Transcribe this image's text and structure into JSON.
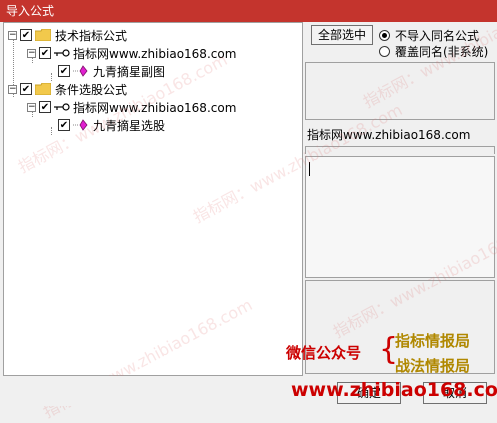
{
  "window": {
    "title": "导入公式"
  },
  "tree": {
    "nodes": [
      {
        "label": "技术指标公式",
        "type": "category"
      },
      {
        "label": "指标网www.zhibiao168.com",
        "type": "group"
      },
      {
        "label": "九青摘星副图",
        "type": "formula"
      },
      {
        "label": "条件选股公式",
        "type": "category"
      },
      {
        "label": "指标网www.zhibiao168.com",
        "type": "group"
      },
      {
        "label": "九青摘星选股",
        "type": "formula"
      }
    ]
  },
  "actions": {
    "select_all_label": "全部选中",
    "ok_label": "确定",
    "cancel_label": "取消"
  },
  "import_options": {
    "options": [
      {
        "label": "不导入同名公式",
        "selected": true
      },
      {
        "label": "覆盖同名(非系统)",
        "selected": false
      }
    ]
  },
  "detail": {
    "source_text": "指标网www.zhibiao168.com",
    "note_text": ""
  },
  "watermark": {
    "text": "指标网：www.zhibiao168.com"
  },
  "promo": {
    "wechat_label": "微信公众号",
    "brace": "{",
    "channel1": "指标情报局",
    "channel2": "战法情报局",
    "url": "www.zhibiao168.com"
  },
  "colors": {
    "titlebar": "#c4342d",
    "check": "#000000",
    "promo_red": "#cc0000",
    "promo_gold": "#b08800"
  }
}
